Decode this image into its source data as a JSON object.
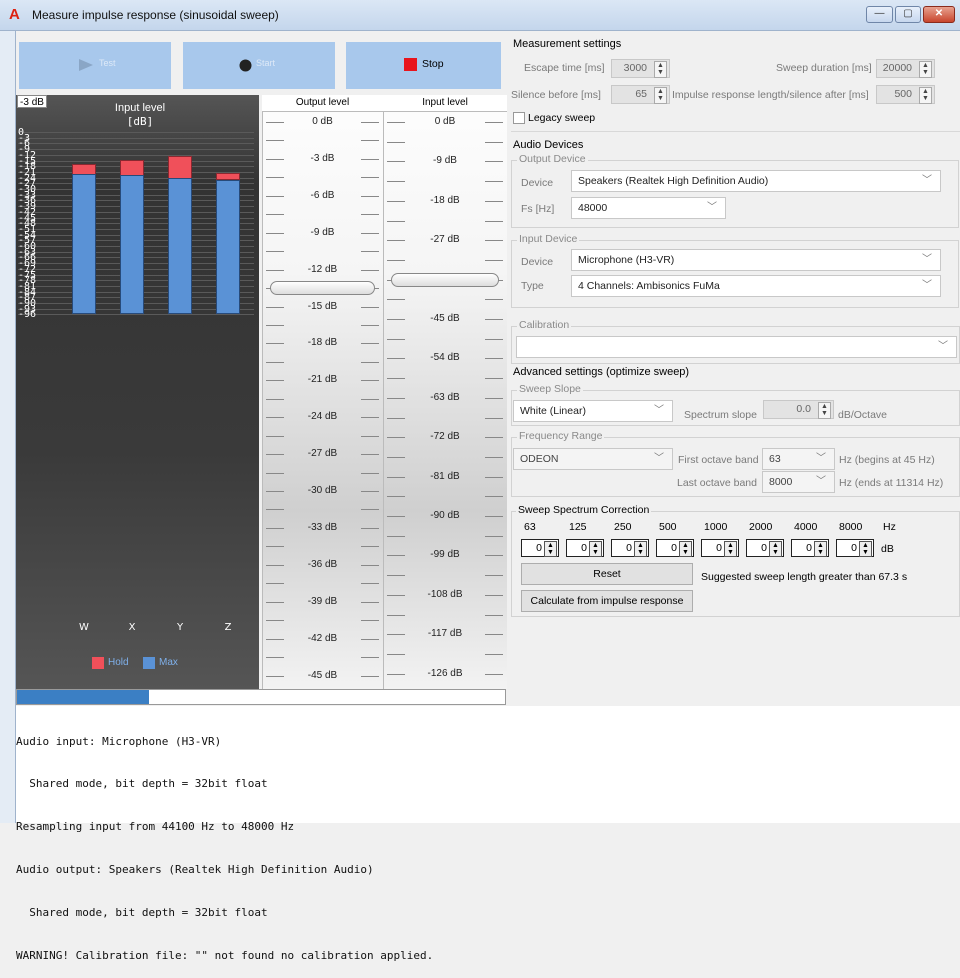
{
  "window": {
    "title": "Measure impulse response (sinusoidal sweep)",
    "controls": [
      "—",
      "▢",
      "✕"
    ]
  },
  "toolbar": {
    "test_label": "Test",
    "start_label": "Start",
    "stop_label": "Stop"
  },
  "meter": {
    "badge": "-3 dB",
    "title_line1": "Input level",
    "title_line2": "[dB]",
    "ticks": [
      "0",
      "-3",
      "-6",
      "-9",
      "-12",
      "-15",
      "-18",
      "-21",
      "-24",
      "-27",
      "-30",
      "-33",
      "-36",
      "-39",
      "-42",
      "-45",
      "-48",
      "-51",
      "-54",
      "-57",
      "-60",
      "-63",
      "-66",
      "-69",
      "-72",
      "-75",
      "-78",
      "-81",
      "-84",
      "-87",
      "-90",
      "-93",
      "-96"
    ],
    "channels": [
      {
        "name": "W",
        "max_db": -22.0,
        "hold_db": -17.0
      },
      {
        "name": "X",
        "max_db": -22.5,
        "hold_db": -14.5
      },
      {
        "name": "Y",
        "max_db": -24.0,
        "hold_db": -12.7
      },
      {
        "name": "Z",
        "max_db": -25.0,
        "hold_db": -21.5
      }
    ],
    "legend_hold": "Hold",
    "legend_max": "Max",
    "colors": {
      "hold": "#f0505a",
      "max": "#5a92d6"
    }
  },
  "output_level": {
    "header": "Output level",
    "labels": [
      "0 dB",
      "-3 dB",
      "-6 dB",
      "-9 dB",
      "-12 dB",
      "-15 dB",
      "-18 dB",
      "-21 dB",
      "-24 dB",
      "-27 dB",
      "-30 dB",
      "-33 dB",
      "-36 dB",
      "-39 dB",
      "-42 dB",
      "-45 dB"
    ],
    "value_db": -13.5
  },
  "input_level": {
    "header": "Input level",
    "labels": [
      "0 dB",
      "-9 dB",
      "-18 dB",
      "-27 dB",
      "-36 dB",
      "-45 dB",
      "-54 dB",
      "-63 dB",
      "-72 dB",
      "-81 dB",
      "-90 dB",
      "-99 dB",
      "-108 dB",
      "-117 dB",
      "-126 dB"
    ],
    "value_db": -36
  },
  "progress": {
    "value_pct": 27
  },
  "log": [
    "Audio input: Microphone (H3-VR)",
    "  Shared mode, bit depth = 32bit float",
    "Resampling input from 44100 Hz to 48000 Hz",
    "Audio output: Speakers (Realtek High Definition Audio)",
    "  Shared mode, bit depth = 32bit float",
    "WARNING! Calibration file: \"\" not found no calibration applied."
  ],
  "settings": {
    "measurement_title": "Measurement settings",
    "escape_label": "Escape time [ms]",
    "escape_value": "3000",
    "sweep_dur_label": "Sweep duration [ms]",
    "sweep_dur_value": "20000",
    "silence_label": "Silence before [ms]",
    "silence_value": "65",
    "ir_len_label": "Impulse response length/silence after [ms]",
    "ir_len_value": "500",
    "legacy_label": "Legacy sweep",
    "audio_devices_title": "Audio Devices",
    "output_device_group": "Output Device",
    "output_device_label": "Device",
    "output_device_value": "Speakers (Realtek High Definition Audio)",
    "fs_label": "Fs [Hz]",
    "fs_value": "48000",
    "input_device_group": "Input Device",
    "input_device_label": "Device",
    "input_device_value": "Microphone (H3-VR)",
    "type_label": "Type",
    "type_value": "4 Channels: Ambisonics FuMa",
    "calibration_group": "Calibration",
    "calibration_value": "",
    "advanced_title": "Advanced settings (optimize sweep)",
    "sweep_slope_group": "Sweep Slope",
    "sweep_slope_value": "White (Linear)",
    "spectrum_slope_label": "Spectrum slope",
    "spectrum_slope_value": "0.0",
    "spectrum_slope_unit": "dB/Octave",
    "freq_range_group": "Frequency Range",
    "freq_range_value": "ODEON",
    "first_band_label": "First octave band",
    "first_band_value": "63",
    "first_band_note": "Hz (begins at 45 Hz)",
    "last_band_label": "Last octave band",
    "last_band_value": "8000",
    "last_band_note": "Hz (ends at 11314 Hz)",
    "correction_group": "Sweep Spectrum Correction",
    "bands": [
      "63",
      "125",
      "250",
      "500",
      "1000",
      "2000",
      "4000",
      "8000"
    ],
    "band_unit": "Hz",
    "band_values": [
      "0",
      "0",
      "0",
      "0",
      "0",
      "0",
      "0",
      "0"
    ],
    "value_unit": "dB",
    "reset_label": "Reset",
    "suggestion": "Suggested sweep length greater than 67.3 s",
    "calc_label": "Calculate from impulse response"
  }
}
